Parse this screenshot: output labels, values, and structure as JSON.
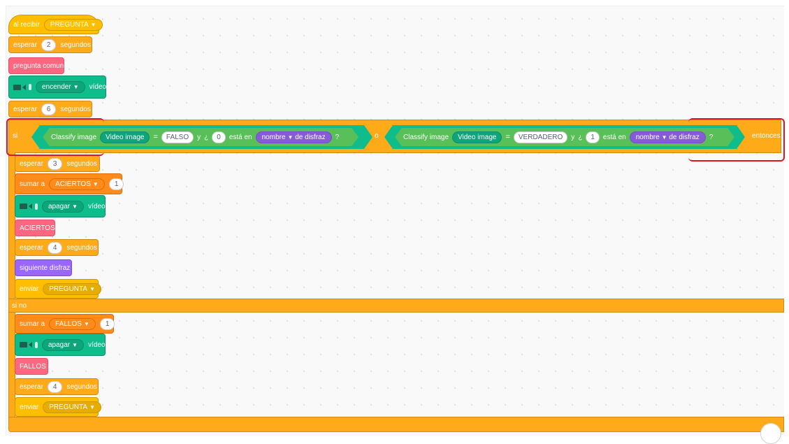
{
  "script": {
    "hat": {
      "label": "al recibir",
      "message": "PREGUNTA"
    },
    "wait1": {
      "label": "esperar",
      "value": "2",
      "unit": "segundos"
    },
    "question": {
      "label": "pregunta comun"
    },
    "video_on": {
      "value": "encender",
      "suffix": "vídeo"
    },
    "wait2": {
      "label": "esperar",
      "value": "6",
      "unit": "segundos"
    },
    "if_block": {
      "si": "si",
      "entonces": "entonces",
      "sino": "si no",
      "cond1": {
        "classify": "Classify image",
        "source": "Video image",
        "eq": "=",
        "result": "FALSO",
        "and": "y",
        "q_open": "¿",
        "num": "0",
        "in": "está en",
        "costume_attr": "nombre",
        "of_costume": "de disfraz",
        "q_close": "?"
      },
      "or": "o",
      "cond2": {
        "classify": "Classify image",
        "source": "Video image",
        "eq": "=",
        "result": "VERDADERO",
        "and": "y",
        "q_open": "¿",
        "num": "1",
        "in": "está en",
        "costume_attr": "nombre",
        "of_costume": "de disfraz",
        "q_close": "?"
      }
    },
    "then_branch": {
      "wait": {
        "label": "esperar",
        "value": "3",
        "unit": "segundos"
      },
      "add": {
        "label": "sumar a",
        "var": "ACIERTOS",
        "value": "1"
      },
      "video_off": {
        "value": "apagar",
        "suffix": "vídeo"
      },
      "aciertos": {
        "label": "ACIERTOS"
      },
      "wait2": {
        "label": "esperar",
        "value": "4",
        "unit": "segundos"
      },
      "next_costume": {
        "label": "siguiente disfraz"
      },
      "send": {
        "label": "enviar",
        "message": "PREGUNTA"
      }
    },
    "else_branch": {
      "add": {
        "label": "sumar a",
        "var": "FALLOS",
        "value": "1"
      },
      "video_off": {
        "value": "apagar",
        "suffix": "vídeo"
      },
      "fallos": {
        "label": "FALLOS"
      },
      "wait": {
        "label": "esperar",
        "value": "4",
        "unit": "segundos"
      },
      "send": {
        "label": "enviar",
        "message": "PREGUNTA"
      }
    }
  },
  "colors": {
    "events": "#ffbf00",
    "control": "#ffab19",
    "custom": "#ff6680",
    "extension": "#0fbd8c",
    "looks": "#9966ff",
    "operators": "#59c059",
    "annotation": "#e0141e"
  },
  "icons": {
    "video": "video-camera-icon",
    "dropdown": "caret-down-icon"
  }
}
